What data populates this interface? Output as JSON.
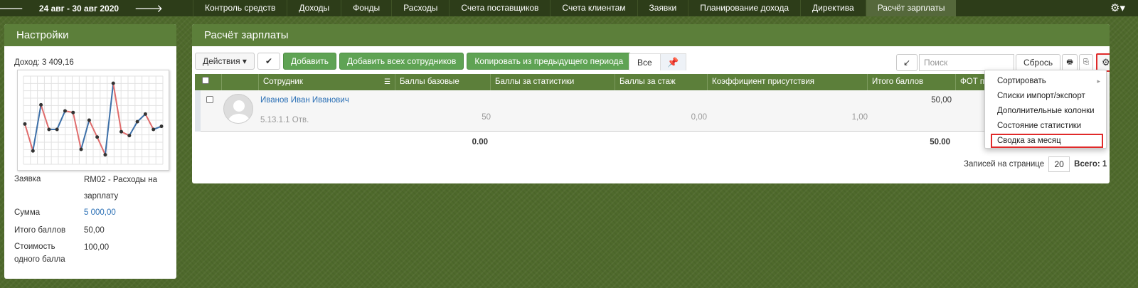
{
  "topbar": {
    "prev_arrow": "🡐",
    "date_range": "24 авг - 30 авг 2020",
    "next_arrow": "🡒",
    "menu": [
      {
        "label": "Контроль средств",
        "active": false
      },
      {
        "label": "Доходы",
        "active": false
      },
      {
        "label": "Фонды",
        "active": false
      },
      {
        "label": "Расходы",
        "active": false
      },
      {
        "label": "Счета поставщиков",
        "active": false
      },
      {
        "label": "Счета клиентам",
        "active": false
      },
      {
        "label": "Заявки",
        "active": false
      },
      {
        "label": "Планирование дохода",
        "active": false
      },
      {
        "label": "Директива",
        "active": false
      },
      {
        "label": "Расчёт зарплаты",
        "active": true
      }
    ],
    "gear_glyph": "⚙▾"
  },
  "settings": {
    "title": "Настройки",
    "income": "Доход: 3 409,16",
    "chart_data": {
      "type": "line",
      "x": [
        1,
        2,
        3,
        4,
        5,
        6,
        7,
        8,
        9,
        10,
        11,
        12,
        13,
        14,
        15,
        16,
        17,
        18
      ],
      "values": [
        0.45,
        0.1,
        0.7,
        0.38,
        0.38,
        0.62,
        0.6,
        0.12,
        0.5,
        0.28,
        0.05,
        0.98,
        0.35,
        0.3,
        0.48,
        0.58,
        0.38,
        0.42
      ],
      "grid": true,
      "colors": {
        "up": "#3c6fa8",
        "down": "#e06c6c",
        "point": "#333333"
      }
    },
    "fields": [
      {
        "label": "Заявка",
        "value": "RM02 - Расходы на зарплату"
      },
      {
        "label": "Сумма",
        "value": "5 000,00"
      },
      {
        "label": "Итого баллов",
        "value": "50,00"
      },
      {
        "label": "Стоимость одного балла",
        "value": "100,00"
      }
    ]
  },
  "main": {
    "title": "Расчёт зарплаты",
    "toolbar": {
      "actions": "Действия ▾",
      "check": "✔",
      "add": "Добавить",
      "add_all": "Добавить всех сотрудников",
      "copy_prev": "Копировать из предыдущего периода"
    },
    "tabs": {
      "all": "Все",
      "pin": "📌"
    },
    "search": {
      "placeholder": "Поиск",
      "reset": "Сбрось",
      "export_icon": "↙",
      "print_icon": "🖶",
      "copy_icon": "⎘",
      "gear": "⚙▾"
    },
    "columns": [
      "Сотрудник",
      "Баллы базовые",
      "Баллы за статистики",
      "Баллы за стаж",
      "Коэффициент присутствия",
      "Итого баллов",
      "ФОТ по"
    ],
    "row": {
      "name": "Иванов Иван Иванович",
      "post": "5.13.1.1 Отв.",
      "base_points": "50",
      "seniority_points": "0,00",
      "presence_coeff": "1,00",
      "total_points": "50,00"
    },
    "totals": {
      "base_points": "0.00",
      "total_points": "50.00"
    },
    "footer": {
      "per_page_label": "Записей на странице",
      "per_page": "20",
      "total_label": "Всего: 1"
    }
  },
  "dropdown": {
    "items": [
      {
        "label": "Сортировать",
        "submenu": true
      },
      {
        "label": "Списки импорт/экспорт",
        "submenu": false
      },
      {
        "label": "Дополнительные колонки",
        "submenu": false
      },
      {
        "label": "Состояние статистики",
        "submenu": false
      },
      {
        "label": "Сводка за месяц",
        "submenu": false
      }
    ],
    "submenu_caret": "▸"
  }
}
